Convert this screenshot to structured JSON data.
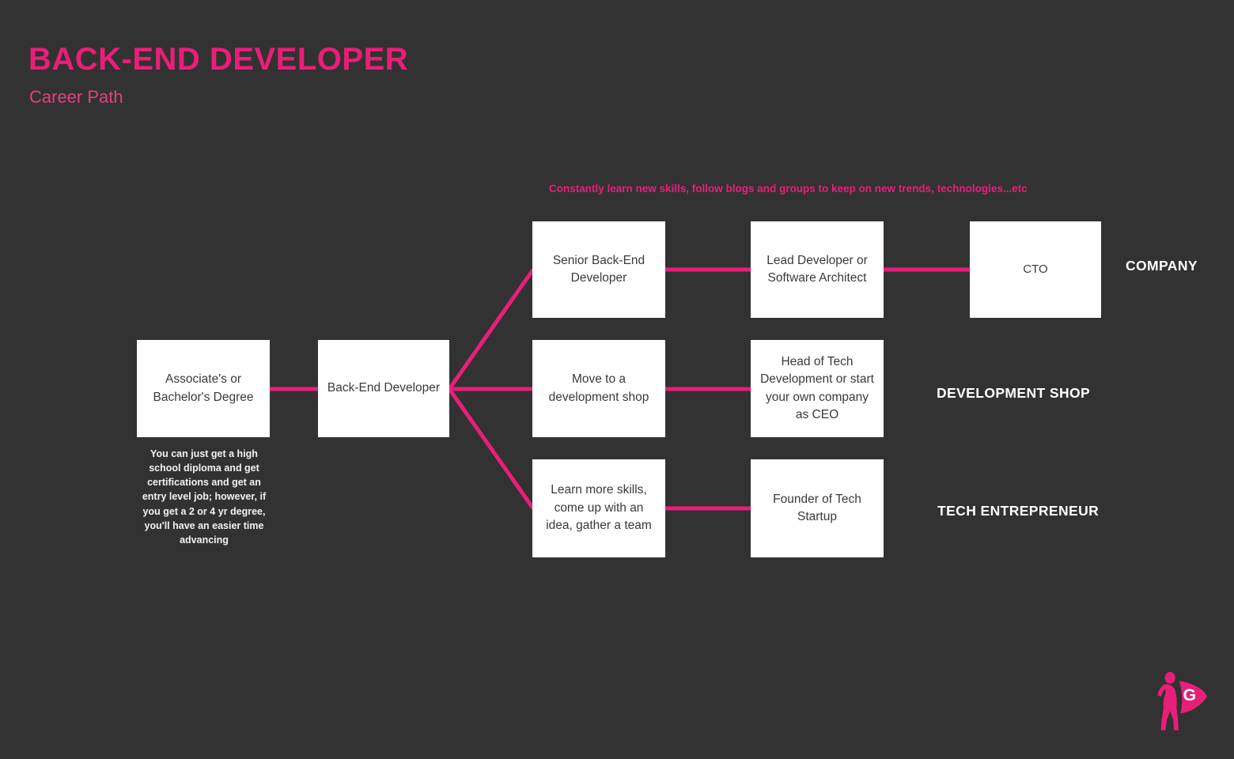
{
  "header": {
    "title": "BACK-END DEVELOPER",
    "subtitle": "Career Path"
  },
  "annotations": {
    "top_note": "Constantly learn new skills, follow blogs and groups to keep on new trends, technologies...etc",
    "degree_note": "You can just  get a high school diploma and get certifications and get an entry level job; however, if you get a 2 or 4 yr degree, you'll have an easier time advancing"
  },
  "colors": {
    "background": "#333232",
    "accent_pink": "#E91E78",
    "node_fill": "#FFFFFF",
    "node_text": "#3A3A3A",
    "label_text": "#FFFFFF"
  },
  "nodes": {
    "degree": "Associate's or Bachelor's Degree",
    "backend_developer": "Back-End Developer",
    "senior_backend_developer": "Senior Back-End Developer",
    "lead_developer": "Lead Developer or Software Architect",
    "cto": "CTO",
    "move_dev_shop": "Move to a development shop",
    "head_of_tech": "Head of Tech Development or start your own company as CEO",
    "learn_more_skills": "Learn more skills, come up with an idea, gather a team",
    "founder_startup": "Founder of Tech Startup"
  },
  "row_labels": [
    "COMPANY",
    "DEVELOPMENT SHOP",
    "TECH ENTREPRENEUR"
  ],
  "logo": {
    "icon": "superhero-cape-icon",
    "letter": "G"
  }
}
